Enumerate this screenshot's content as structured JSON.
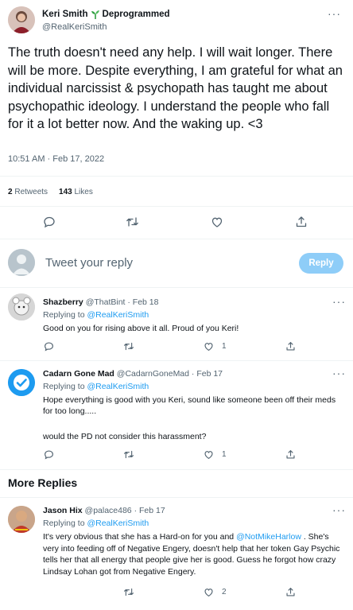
{
  "main_tweet": {
    "author_name": "Keri Smith",
    "badge_text": "Deprogrammed",
    "handle": "@RealKeriSmith",
    "text": "The truth doesn't need any help. I will wait longer. There will be more. Despite everything, I am grateful for what an individual narcissist & psychopath has taught me about psychopathic ideology. I understand the people who fall for it a lot better now. And the waking up. <3",
    "timestamp": "10:51 AM · Feb 17, 2022",
    "retweet_count": "2",
    "retweet_label": "Retweets",
    "like_count": "143",
    "like_label": "Likes"
  },
  "composer": {
    "placeholder": "Tweet your reply",
    "reply_button": "Reply"
  },
  "replies": [
    {
      "name": "Shazberry",
      "handle_date": "@ThatBint · Feb 18",
      "replying_prefix": "Replying to",
      "replying_handle": "@RealKeriSmith",
      "text": "Good on you for rising above it all. Proud of you Keri!",
      "likes": "1"
    },
    {
      "name": "Cadarn Gone Mad",
      "handle_date": "@CadarnGoneMad · Feb 17",
      "replying_prefix": "Replying to",
      "replying_handle": "@RealKeriSmith",
      "text1": "Hope everything is good with you Keri, sound like someone been off their meds for too long.....",
      "text2": "would the PD not consider this harassment?",
      "likes": "1"
    }
  ],
  "more_replies_heading": "More Replies",
  "more_reply": {
    "name": "Jason Hix",
    "handle_date": "@palace486 · Feb 17",
    "replying_prefix": "Replying to",
    "replying_handle": "@RealKeriSmith",
    "text_before": "It's very obvious that she has a Hard-on for you and ",
    "mention": "@NotMikeHarlow",
    "text_after": " . She's very into feeding off of Negative Engery, doesn't help that her token Gay Psychic tells her that all energy that people give her is good. Guess he forgot how crazy Lindsay Lohan got from Negative Engery.",
    "likes": "2"
  },
  "more_menu": "···",
  "colors": {
    "accent": "#1d9bf0",
    "muted": "#536471",
    "divider": "#eff3f4",
    "badge_green": "#2e9e3f"
  },
  "icons": [
    "reply-icon",
    "retweet-icon",
    "like-icon",
    "share-icon",
    "sprout-icon",
    "verified-check-icon"
  ]
}
